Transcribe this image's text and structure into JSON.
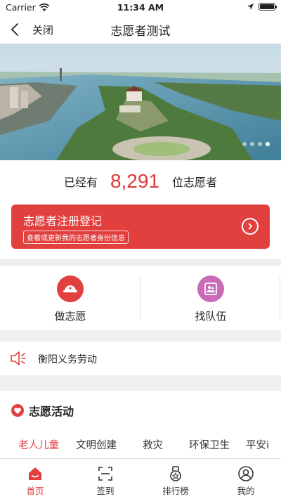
{
  "status_bar": {
    "carrier": "Carrier",
    "time": "11:34 AM"
  },
  "nav": {
    "close_label": "关闭",
    "title": "志愿者测试"
  },
  "banner": {
    "slide_count": 4,
    "active_slide": 4
  },
  "volunteer_count": {
    "prefix": "已经有",
    "number": "8,291",
    "suffix": "位志愿者"
  },
  "register": {
    "title": "志愿者注册登记",
    "subtitle": "查看或更新我的志愿者身份信息"
  },
  "actions": [
    {
      "label": "做志愿",
      "icon": "volunteer-cap-icon",
      "color": "#e2403f"
    },
    {
      "label": "找队伍",
      "icon": "team-photo-icon",
      "color": "#c96bb6"
    }
  ],
  "notice": {
    "text": "衡阳义务劳动",
    "icon": "speaker-icon"
  },
  "activities": {
    "title": "志愿活动",
    "categories": [
      "老人儿童",
      "文明创建",
      "救灾",
      "环保卫生",
      "平安i"
    ],
    "active_category": 0
  },
  "tabs": [
    {
      "label": "首页",
      "icon": "home-icon",
      "active": true
    },
    {
      "label": "签到",
      "icon": "scan-icon",
      "active": false
    },
    {
      "label": "排行榜",
      "icon": "medal-icon",
      "active": false
    },
    {
      "label": "我的",
      "icon": "profile-icon",
      "active": false
    }
  ],
  "colors": {
    "accent": "#e2403f",
    "team_icon": "#c96bb6"
  }
}
